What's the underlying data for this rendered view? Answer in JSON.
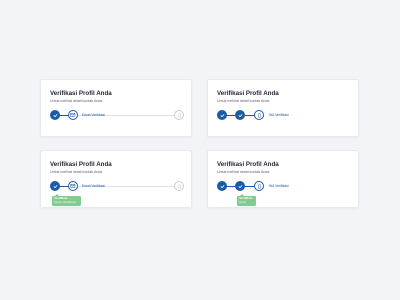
{
  "colors": {
    "primary": "#1b5aa5",
    "success": "#82cc8f",
    "pending": "#c9cdd4",
    "background": "#f2f4f8"
  },
  "cards": [
    {
      "title": "Verifikasi Profil Anda",
      "subtitle": "Untuk melihat detail kontak Anda",
      "steps": [
        {
          "state": "done",
          "icon": "check-icon"
        },
        {
          "state": "active",
          "icon": "mail-icon",
          "label": "Email Verifikasi"
        },
        {
          "state": "pending",
          "icon": "phone-icon"
        }
      ]
    },
    {
      "title": "Verifikasi Profil Anda",
      "subtitle": "Untuk melihat detail kontak Anda",
      "steps": [
        {
          "state": "done",
          "icon": "check-icon"
        },
        {
          "state": "done",
          "icon": "check-icon"
        },
        {
          "state": "active",
          "icon": "phone-icon",
          "label": "WA Verifikasi"
        }
      ]
    },
    {
      "title": "Verifikasi Profil Anda",
      "subtitle": "Untuk melihat detail kontak Anda",
      "steps": [
        {
          "state": "done",
          "icon": "check-icon"
        },
        {
          "state": "active",
          "icon": "mail-icon",
          "label": "Email Verifikasi"
        },
        {
          "state": "pending",
          "icon": "phone-icon"
        }
      ],
      "tooltip": {
        "title": "Verifikasi",
        "text": "Nomor Handphone"
      }
    },
    {
      "title": "Verifikasi Profil Anda",
      "subtitle": "Untuk melihat detail kontak Anda",
      "steps": [
        {
          "state": "done",
          "icon": "check-icon"
        },
        {
          "state": "done",
          "icon": "check-icon"
        },
        {
          "state": "active",
          "icon": "phone-icon",
          "label": "WA Verifikasi"
        }
      ],
      "tooltip": {
        "title": "Verifikasi",
        "text": "Email"
      }
    }
  ]
}
